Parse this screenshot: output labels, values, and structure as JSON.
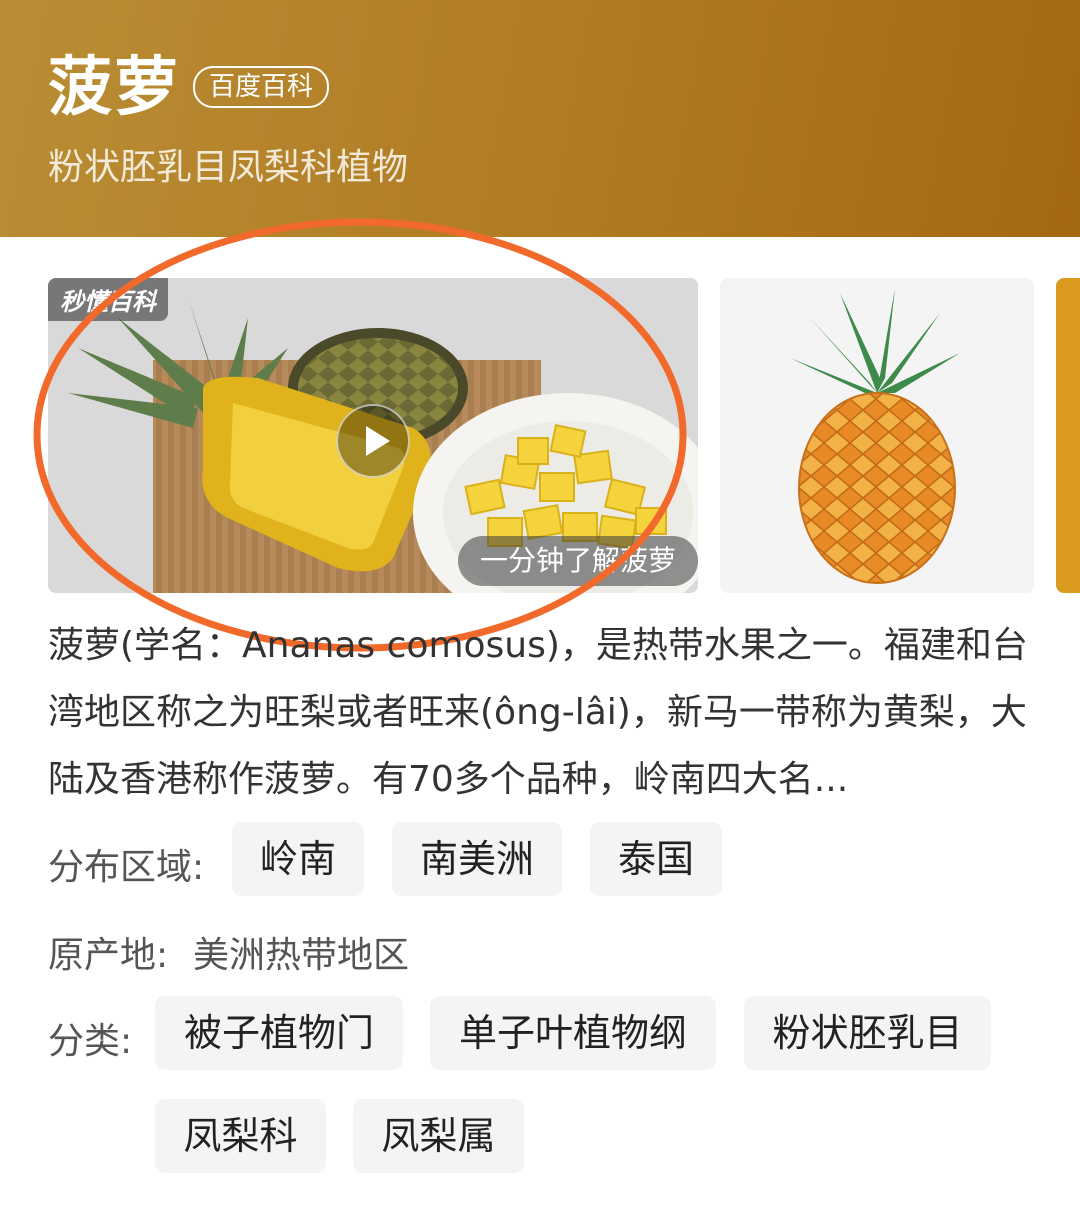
{
  "header": {
    "title": "菠萝",
    "source_badge": "百度百科",
    "subtitle": "粉状胚乳目凤梨科植物",
    "bg_color": "#b07a22"
  },
  "gallery": {
    "video": {
      "watermark": "秒懂百科",
      "caption": "一分钟了解菠萝",
      "play_icon": "play-icon"
    },
    "highlight_color": "#f26a2b"
  },
  "description": "菠萝(学名：Ananas comosus)，是热带水果之一。福建和台湾地区称之为旺梨或者旺来(ông-lâi)，新马一带称为黄梨，大陆及香港称作菠萝。有70多个品种，岭南四大名...",
  "distribution": {
    "label": "分布区域:",
    "items": [
      "岭南",
      "南美洲",
      "泰国"
    ]
  },
  "origin": {
    "label": "原产地:",
    "value": "美洲热带地区"
  },
  "classification": {
    "label": "分类:",
    "items": [
      "被子植物门",
      "单子叶植物纲",
      "粉状胚乳目",
      "凤梨科",
      "凤梨属"
    ]
  }
}
